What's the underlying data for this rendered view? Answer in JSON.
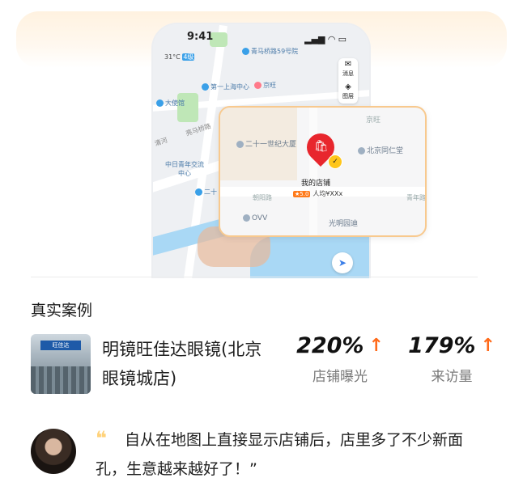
{
  "phone": {
    "time": "9:41",
    "signal": "▂▄▆ ◠ ▭",
    "weather": "31°C",
    "weather_badge": "4级",
    "tools": {
      "messages_label": "消息",
      "layers_label": "图层"
    },
    "map_pois": [
      "青马桥路59号院",
      "第一上海中心",
      "京旺",
      "大使馆",
      "中日青年交流中心",
      "二十",
      "亮马桥路",
      "清河"
    ]
  },
  "zoom_card": {
    "pois": [
      "二十一世纪大厦",
      "北京同仁堂",
      "OVV",
      "光明园迪",
      "京旺",
      "朝阳路",
      "青年路"
    ],
    "store_name": "我的店铺",
    "rating": "5.0",
    "per_capita": "人均¥XXx"
  },
  "case": {
    "section_title": "真实案例",
    "store_name": "明镜旺佳达眼镜(北京眼镜城店)",
    "photo_sign": "旺佳达",
    "metrics": [
      {
        "value": "220%",
        "label": "店铺曝光"
      },
      {
        "value": "179%",
        "label": "来访量"
      }
    ]
  },
  "testimonial": {
    "quote": "自从在地图上直接显示店铺后，店里多了不少新面孔，生意越来越好了！”"
  },
  "colors": {
    "accent_orange": "#ff6a1a",
    "card_border": "#f8c98e",
    "pin_red": "#e8262d"
  }
}
